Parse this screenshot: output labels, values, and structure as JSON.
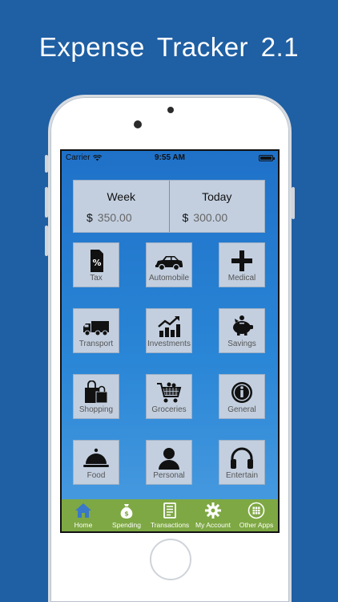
{
  "headline": "Expense Tracker  2.1",
  "status": {
    "carrier": "Carrier",
    "time": "9:55 AM"
  },
  "summary": {
    "week": {
      "label": "Week",
      "currency": "$",
      "amount": "350.00"
    },
    "today": {
      "label": "Today",
      "currency": "$",
      "amount": "300.00"
    }
  },
  "categories": [
    {
      "label": "Tax",
      "icon": "tax-document-icon"
    },
    {
      "label": "Automobile",
      "icon": "car-icon"
    },
    {
      "label": "Medical",
      "icon": "medical-cross-icon"
    },
    {
      "label": "Transport",
      "icon": "truck-icon"
    },
    {
      "label": "Investments",
      "icon": "chart-growth-icon"
    },
    {
      "label": "Savings",
      "icon": "piggy-bank-icon"
    },
    {
      "label": "Shopping",
      "icon": "shopping-bags-icon"
    },
    {
      "label": "Groceries",
      "icon": "shopping-cart-icon"
    },
    {
      "label": "General",
      "icon": "info-icon"
    },
    {
      "label": "Food",
      "icon": "food-cloche-icon"
    },
    {
      "label": "Personal",
      "icon": "person-icon"
    },
    {
      "label": "Entertain",
      "icon": "headphones-icon"
    }
  ],
  "tabs": [
    {
      "label": "Home",
      "icon": "home-icon"
    },
    {
      "label": "Spending",
      "icon": "money-bag-icon"
    },
    {
      "label": "Transactions",
      "icon": "receipt-icon"
    },
    {
      "label": "My Account",
      "icon": "gear-icon"
    },
    {
      "label": "Other Apps",
      "icon": "apps-grid-icon"
    }
  ],
  "colors": {
    "background": "#1f5fa3",
    "tile": "#c3cfdf",
    "tabbar": "#7ea843",
    "active_tab": "#3a78c8"
  }
}
